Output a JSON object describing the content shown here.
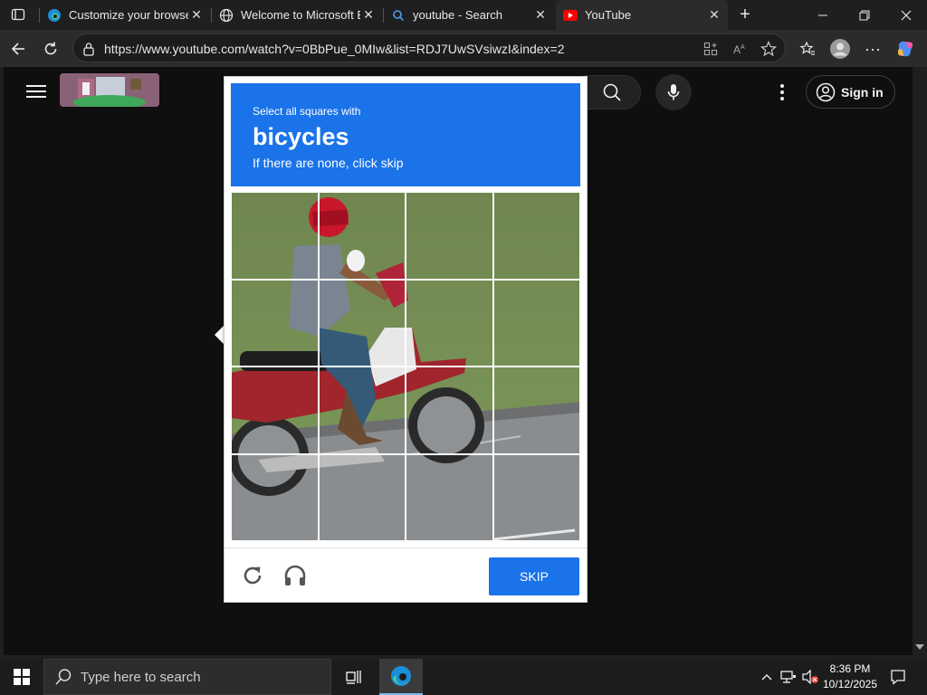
{
  "browser": {
    "tabs": [
      {
        "title": "Customize your browser",
        "favicon": "edge-icon"
      },
      {
        "title": "Welcome to Microsoft Ed",
        "favicon": "globe-icon"
      },
      {
        "title": "youtube - Search",
        "favicon": "search-icon"
      },
      {
        "title": "YouTube",
        "favicon": "youtube-icon",
        "active": true
      }
    ],
    "url": "https://www.youtube.com/watch?v=0BbPue_0MIw&list=RDJ7UwSVsiwzI&index=2"
  },
  "youtube": {
    "signin_label": "Sign in"
  },
  "captcha": {
    "instruction_small": "Select all squares with",
    "target": "bicycles",
    "hint": "If there are none, click skip",
    "skip_label": "SKIP",
    "grid_size": 4,
    "header_color": "#1a73e8"
  },
  "taskbar": {
    "search_placeholder": "Type here to search",
    "time": "8:36 PM",
    "date": "10/12/2025"
  }
}
